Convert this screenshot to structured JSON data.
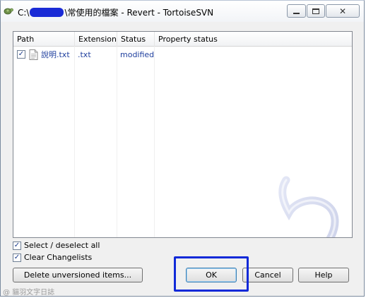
{
  "window": {
    "title_prefix": "C:\\",
    "title_suffix": "\\常使用的檔案 - Revert - TortoiseSVN",
    "close_glyph": "✕"
  },
  "list": {
    "columns": [
      "Path",
      "Extension",
      "Status",
      "Property status"
    ],
    "rows": [
      {
        "checked": true,
        "path": "說明.txt",
        "extension": ".txt",
        "status": "modified",
        "property_status": ""
      }
    ]
  },
  "options": {
    "select_all": {
      "label": "Select / deselect all",
      "checked": true
    },
    "clear_changelists": {
      "label": "Clear Changelists",
      "checked": true
    }
  },
  "buttons": {
    "delete_unversioned": "Delete unversioned items...",
    "ok": "OK",
    "cancel": "Cancel",
    "help": "Help"
  },
  "credit": "@ 貓羽文字日誌",
  "check_glyph": "✓",
  "colors": {
    "highlight": "#1029d8",
    "redaction": "#1a2bd6",
    "list_text": "#1f3f9e"
  }
}
